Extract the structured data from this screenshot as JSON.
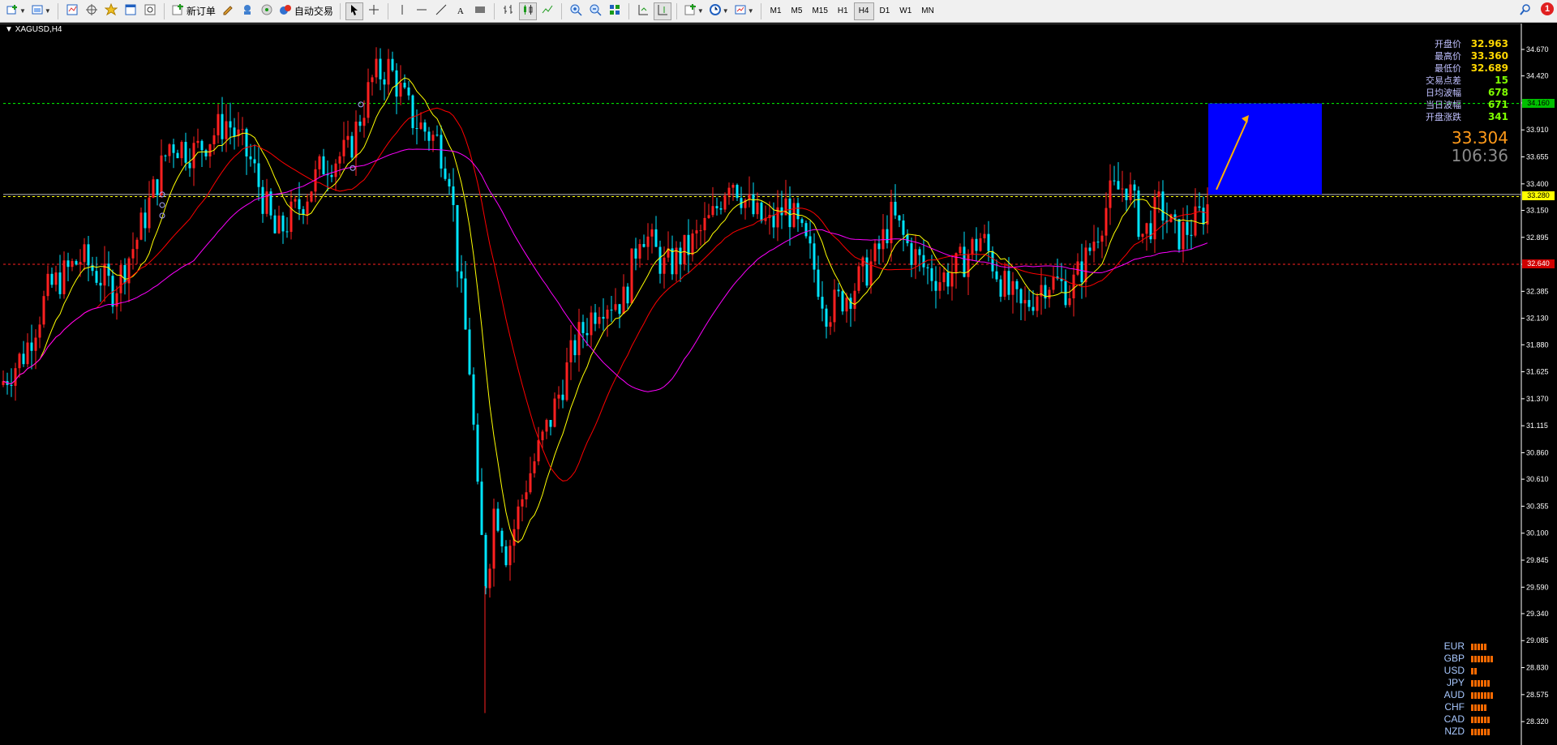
{
  "toolbar": {
    "new_order_label": "新订单",
    "auto_trade_label": "自动交易",
    "timeframes": [
      "M1",
      "M5",
      "M15",
      "H1",
      "H4",
      "D1",
      "W1",
      "MN"
    ],
    "active_timeframe": "H4",
    "alert_count": "1",
    "icons": [
      "new-chart-icon",
      "profiles-icon",
      "market-watch-icon",
      "navigator-icon",
      "favorites-icon",
      "terminal-icon",
      "strategy-tester-icon",
      "new-order-icon",
      "metaeditor-icon",
      "history-icon",
      "signals-icon",
      "auto-trade-icon",
      "cursor-icon",
      "crosshair-icon",
      "vline-icon",
      "hline-icon",
      "trendline-icon",
      "text-icon",
      "label-icon",
      "bar-chart-icon",
      "candle-chart-icon",
      "line-chart-icon",
      "zoom-in-icon",
      "zoom-out-icon",
      "tile-icon",
      "autoscroll-icon",
      "chart-shift-icon",
      "indicators-icon",
      "periods-icon",
      "templates-icon",
      "search-icon"
    ]
  },
  "chart": {
    "symbol_label": "XAGUSD,H4",
    "info": [
      {
        "label": "开盘价",
        "value": "32.963",
        "color": "yellow"
      },
      {
        "label": "最高价",
        "value": "33.360",
        "color": "yellow"
      },
      {
        "label": "最低价",
        "value": "32.689",
        "color": "yellow"
      },
      {
        "label": "交易点差",
        "value": "15",
        "color": "green"
      },
      {
        "label": "日均波幅",
        "value": "678",
        "color": "green"
      },
      {
        "label": "当日波幅",
        "value": "671",
        "color": "green"
      },
      {
        "label": "开盘涨跌",
        "value": "341",
        "color": "green"
      }
    ],
    "current_price": "33.304",
    "countdown": "106:36",
    "price_axis": [
      "34.670",
      "34.420",
      "34.165",
      "33.910",
      "33.655",
      "33.400",
      "33.150",
      "32.895",
      "32.640",
      "32.385",
      "32.130",
      "31.880",
      "31.625",
      "31.370",
      "31.115",
      "30.860",
      "30.610",
      "30.355",
      "30.100",
      "29.845",
      "29.590",
      "29.340",
      "29.085",
      "28.830",
      "28.575",
      "28.320"
    ],
    "price_tags": [
      {
        "value": "34.160",
        "bg": "#00c000",
        "fg": "#000"
      },
      {
        "value": "33.280",
        "bg": "#ffff00",
        "fg": "#000"
      },
      {
        "value": "32.640",
        "bg": "#d00000",
        "fg": "#fff"
      }
    ],
    "colors": {
      "bull": "#ff2020",
      "bear": "#00e5ff",
      "ma_fast": "#ffff00",
      "ma_mid": "#ff0000",
      "ma_slow": "#ff00ff",
      "target_box": "#0000ff",
      "arrow": "#ffb000"
    }
  },
  "currencies": [
    {
      "name": "EUR",
      "strength": 5
    },
    {
      "name": "GBP",
      "strength": 7
    },
    {
      "name": "USD",
      "strength": 2
    },
    {
      "name": "JPY",
      "strength": 6
    },
    {
      "name": "AUD",
      "strength": 7
    },
    {
      "name": "CHF",
      "strength": 5
    },
    {
      "name": "CAD",
      "strength": 6
    },
    {
      "name": "NZD",
      "strength": 6
    }
  ]
}
